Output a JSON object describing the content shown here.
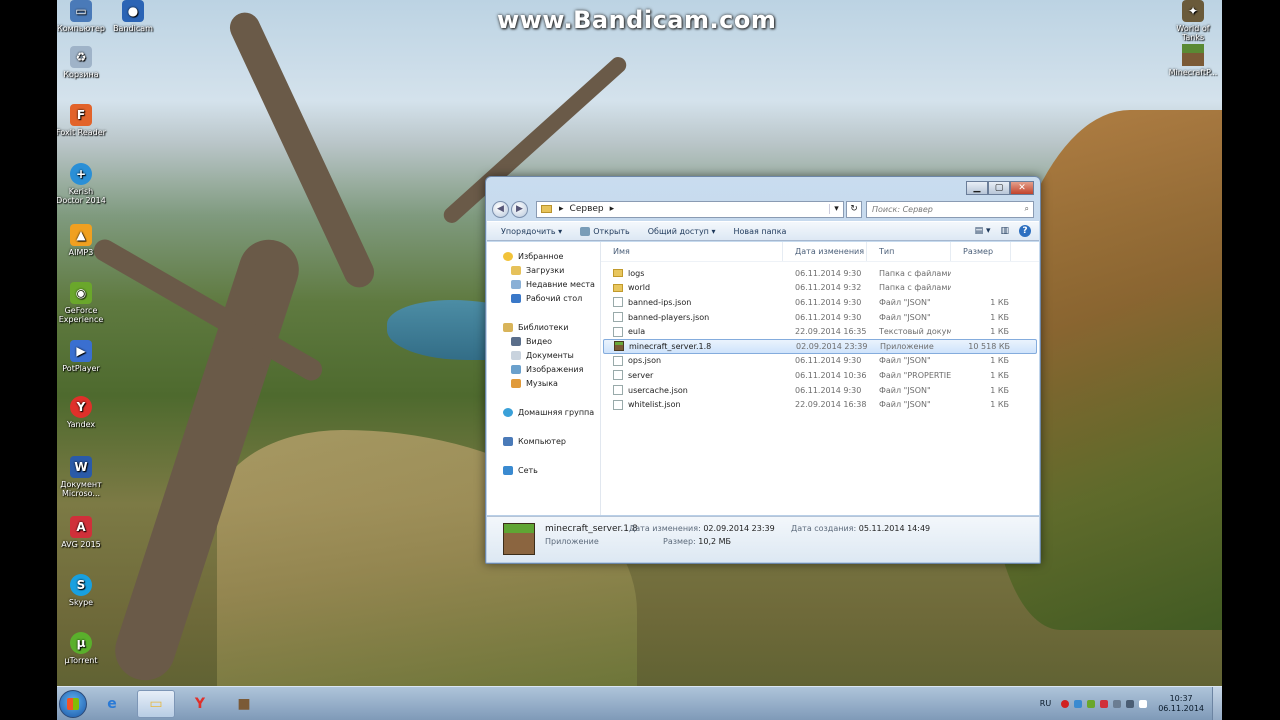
{
  "watermark": "www.Bandicam.com",
  "desktop_icons": [
    {
      "label": "Компьютер",
      "icon": "computer-icon",
      "color": "#4a7ab8"
    },
    {
      "label": "Bandicam",
      "icon": "bandicam-icon",
      "color": "#2b64b5"
    },
    {
      "label": "Корзина",
      "icon": "recycle-bin-icon",
      "color": "#9fb3c8"
    },
    {
      "label": "Foxit Reader",
      "icon": "foxit-icon",
      "color": "#e2632a"
    },
    {
      "label": "Kerish Doctor 2014",
      "icon": "kerish-icon",
      "color": "#2a8fd6"
    },
    {
      "label": "AIMP3",
      "icon": "aimp-icon",
      "color": "#f0a020"
    },
    {
      "label": "GeForce Experience",
      "icon": "geforce-icon",
      "color": "#6aa72b"
    },
    {
      "label": "PotPlayer",
      "icon": "potplayer-icon",
      "color": "#3a6fd0"
    },
    {
      "label": "Yandex",
      "icon": "yandex-icon",
      "color": "#e0302a"
    },
    {
      "label": "Документ Microso...",
      "icon": "word-icon",
      "color": "#2a5aa8"
    },
    {
      "label": "AVG 2015",
      "icon": "avg-icon",
      "color": "#d0303a"
    },
    {
      "label": "Skype",
      "icon": "skype-icon",
      "color": "#18a0e0"
    },
    {
      "label": "µTorrent",
      "icon": "utorrent-icon",
      "color": "#5ab02c"
    },
    {
      "label": "World of Tanks",
      "icon": "wot-icon",
      "color": "#6a5a3a"
    },
    {
      "label": "MinecraftP...",
      "icon": "minecraft-icon",
      "color": "#5a8a34"
    }
  ],
  "window": {
    "controls": {
      "minimize": "▁",
      "maximize": "▢",
      "close": "✕"
    },
    "nav": {
      "back": "◀",
      "forward": "▶"
    },
    "address": {
      "crumb_sep": "▸",
      "path": "Сервер",
      "dropdown": "▾",
      "refresh": "↻"
    },
    "search": {
      "placeholder": "Поиск: Сервер",
      "icon": "⌕"
    },
    "commands": {
      "organize": "Упорядочить ▾",
      "open": "Открыть",
      "share": "Общий доступ ▾",
      "new_folder": "Новая папка",
      "view": "▤ ▾",
      "pane": "▥",
      "help": "?"
    },
    "sidebar": {
      "favorites": "Избранное",
      "favorites_items": [
        "Загрузки",
        "Недавние места",
        "Рабочий стол"
      ],
      "libraries": "Библиотеки",
      "libraries_items": [
        "Видео",
        "Документы",
        "Изображения",
        "Музыка"
      ],
      "homegroup": "Домашняя группа",
      "computer": "Компьютер",
      "network": "Сеть"
    },
    "columns": {
      "name": "Имя",
      "date": "Дата изменения",
      "type": "Тип",
      "size": "Размер"
    },
    "files": [
      {
        "name": "logs",
        "date": "06.11.2014 9:30",
        "type": "Папка с файлами",
        "size": "",
        "kind": "folder"
      },
      {
        "name": "world",
        "date": "06.11.2014 9:32",
        "type": "Папка с файлами",
        "size": "",
        "kind": "folder"
      },
      {
        "name": "banned-ips.json",
        "date": "06.11.2014 9:30",
        "type": "Файл \"JSON\"",
        "size": "1 КБ",
        "kind": "file"
      },
      {
        "name": "banned-players.json",
        "date": "06.11.2014 9:30",
        "type": "Файл \"JSON\"",
        "size": "1 КБ",
        "kind": "file"
      },
      {
        "name": "eula",
        "date": "22.09.2014 16:35",
        "type": "Текстовый докум...",
        "size": "1 КБ",
        "kind": "file"
      },
      {
        "name": "minecraft_server.1.8",
        "date": "02.09.2014 23:39",
        "type": "Приложение",
        "size": "10 518 КБ",
        "kind": "exe",
        "selected": true
      },
      {
        "name": "ops.json",
        "date": "06.11.2014 9:30",
        "type": "Файл \"JSON\"",
        "size": "1 КБ",
        "kind": "file"
      },
      {
        "name": "server",
        "date": "06.11.2014 10:36",
        "type": "Файл \"PROPERTIE...",
        "size": "1 КБ",
        "kind": "file"
      },
      {
        "name": "usercache.json",
        "date": "06.11.2014 9:30",
        "type": "Файл \"JSON\"",
        "size": "1 КБ",
        "kind": "file"
      },
      {
        "name": "whitelist.json",
        "date": "22.09.2014 16:38",
        "type": "Файл \"JSON\"",
        "size": "1 КБ",
        "kind": "file"
      }
    ],
    "details": {
      "name": "minecraft_server.1.8",
      "type": "Приложение",
      "modified_label": "Дата изменения:",
      "modified": "02.09.2014 23:39",
      "size_label": "Размер:",
      "size": "10,2 МБ",
      "created_label": "Дата создания:",
      "created": "05.11.2014 14:49"
    }
  },
  "taskbar": {
    "lang": "RU",
    "time": "10:37",
    "date": "06.11.2014",
    "pinned": [
      {
        "icon": "ie-icon",
        "glyph": "e",
        "color": "#2a7ad6"
      },
      {
        "icon": "explorer-folder-icon",
        "glyph": "▭",
        "color": "#e6b73c"
      },
      {
        "icon": "yandex-browser-icon",
        "glyph": "Y",
        "color": "#e0302a"
      },
      {
        "icon": "minecraft-server-icon",
        "glyph": "■",
        "color": "#7b5a36"
      }
    ]
  }
}
